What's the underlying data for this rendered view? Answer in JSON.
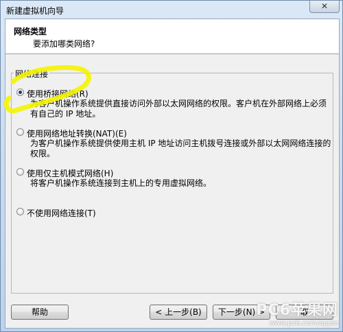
{
  "window": {
    "title": "新建虚拟机向导",
    "close_glyph": "✕"
  },
  "header": {
    "title": "网络类型",
    "subtitle": "要添加哪类网络?"
  },
  "group": {
    "legend": "网络连接",
    "options": [
      {
        "label": "使用桥接网络(R)",
        "checked": true,
        "description": "为客户机操作系统提供直接访问外部以太网网络的权限。客户机在外部网络上必须有自己的 IP 地址。"
      },
      {
        "label": "使用网络地址转换(NAT)(E)",
        "checked": false,
        "description": "为客户机操作系统提供使用主机 IP 地址访问主机拨号连接或外部以太网网络连接的权限。"
      },
      {
        "label": "使用仅主机模式网络(H)",
        "checked": false,
        "description": "将客户机操作系统连接到主机上的专用虚拟网络。"
      },
      {
        "label": "不使用网络连接(T)",
        "checked": false,
        "description": ""
      }
    ]
  },
  "buttons": {
    "help": "帮助",
    "back": "< 上一步(B)",
    "next": "下一步(N) >",
    "cancel": "取"
  },
  "watermark": {
    "brand": "PC6苹果网",
    "url": "www.pc6.com/apple"
  },
  "colors": {
    "highlight": "#f4f400",
    "radio_dot": "#1a3d6e"
  }
}
